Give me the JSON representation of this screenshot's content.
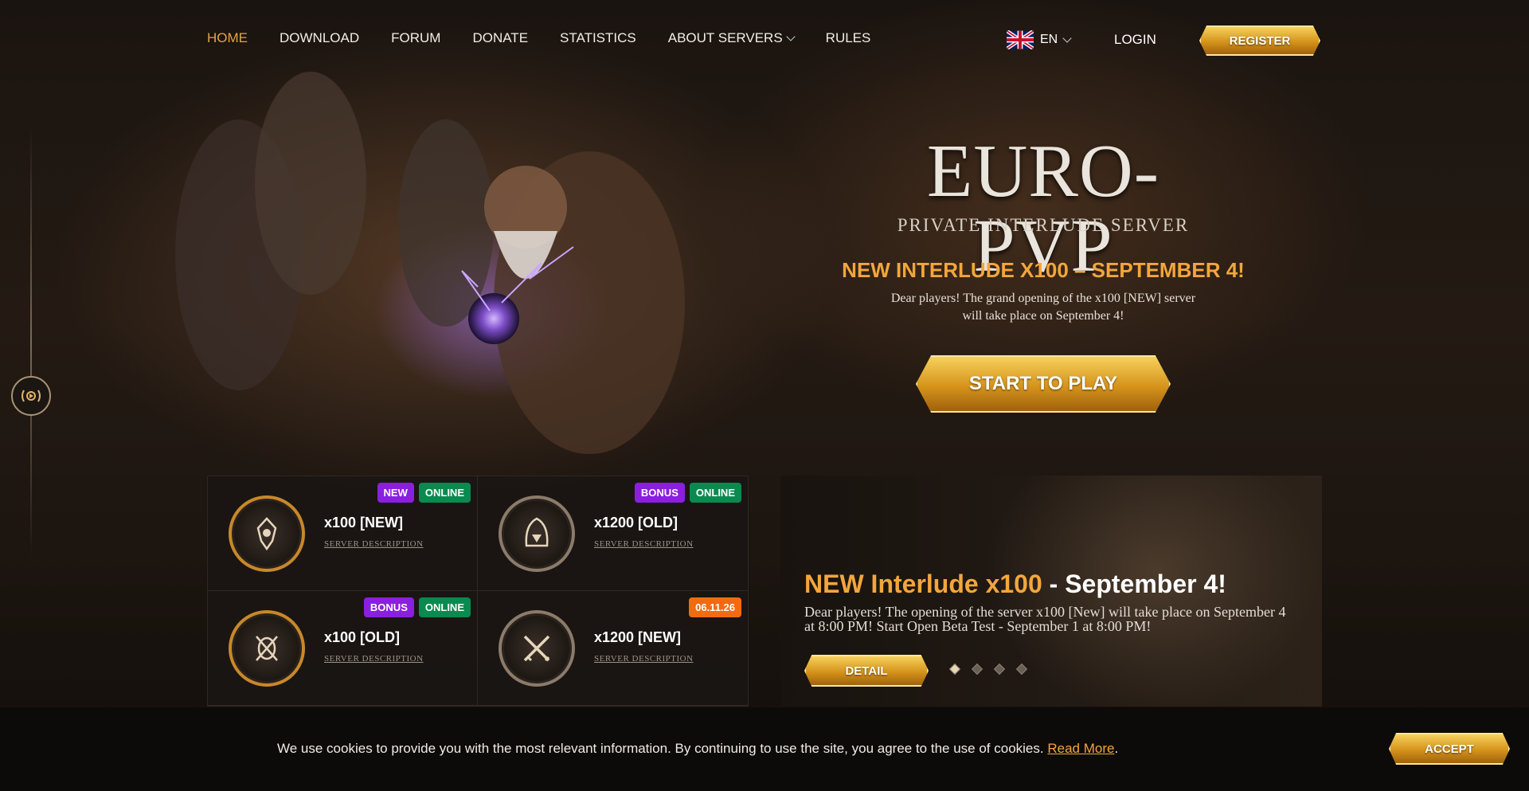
{
  "nav": {
    "items": [
      {
        "label": "HOME",
        "active": true
      },
      {
        "label": "DOWNLOAD"
      },
      {
        "label": "FORUM"
      },
      {
        "label": "DONATE"
      },
      {
        "label": "STATISTICS"
      },
      {
        "label": "ABOUT SERVERS",
        "has_dropdown": true
      },
      {
        "label": "RULES"
      }
    ],
    "language": "EN",
    "login_label": "LOGIN",
    "register_label": "REGISTER"
  },
  "hero": {
    "logo_title": "EURO-PVP",
    "logo_subtitle": "PRIVATE INTERLUDE SERVER",
    "headline": "NEW INTERLUDE X100 – SEPTEMBER 4!",
    "description": "Dear players! The grand opening of the x100 [NEW] server will take place on September 4!",
    "cta_label": "START TO PLAY"
  },
  "servers": [
    {
      "name": "x100 [NEW]",
      "link": "SERVER DESCRIPTION",
      "icon": "dragon-emblem-icon",
      "badges": [
        {
          "text": "NEW",
          "color": "#8a1fe0"
        },
        {
          "text": "ONLINE",
          "color": "#0a8a4f"
        }
      ]
    },
    {
      "name": "x1200 [OLD]",
      "link": "SERVER DESCRIPTION",
      "icon": "hooded-figure-icon",
      "badges": [
        {
          "text": "BONUS",
          "color": "#8a1fe0"
        },
        {
          "text": "ONLINE",
          "color": "#0a8a4f"
        }
      ]
    },
    {
      "name": "x100 [OLD]",
      "link": "SERVER DESCRIPTION",
      "icon": "mask-shield-icon",
      "badges": [
        {
          "text": "BONUS",
          "color": "#8a1fe0"
        },
        {
          "text": "ONLINE",
          "color": "#0a8a4f"
        }
      ]
    },
    {
      "name": "x1200 [NEW]",
      "link": "SERVER DESCRIPTION",
      "icon": "crossed-swords-icon",
      "badges": [
        {
          "text": "06.11.26",
          "color": "#f26a12"
        }
      ]
    }
  ],
  "news": {
    "title_highlight": "NEW Interlude x100",
    "title_rest": " - September 4!",
    "text": "Dear players! The opening of the server x100 [New] will take place on September 4 at 8:00 PM! Start Open Beta Test - September 1 at 8:00 PM!",
    "detail_label": "DETAIL",
    "slides": 4,
    "active_slide": 1
  },
  "cookie": {
    "text": "We use cookies to provide you with the most relevant information. By continuing to use the site, you agree to the use of cookies.",
    "link": "Read More",
    "trailing": ".",
    "accept_label": "ACCEPT"
  },
  "colors": {
    "accent": "#f3a63b",
    "gold": "#d5931b",
    "badge_purple": "#8a1fe0",
    "badge_green": "#0a8a4f",
    "badge_orange": "#f26a12"
  }
}
